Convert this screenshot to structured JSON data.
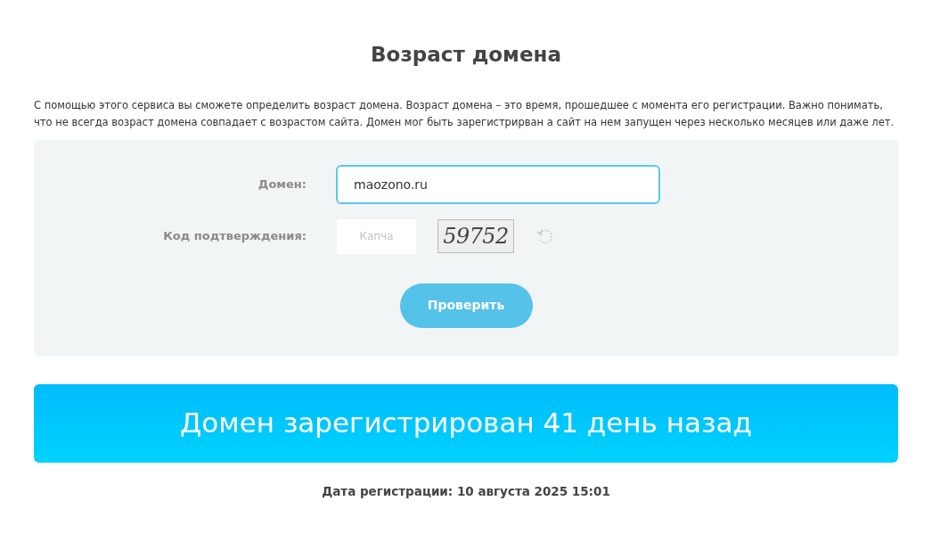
{
  "title": "Возраст домена",
  "description": "С помощью этого сервиса вы сможете определить возраст домена. Возраст домена – это время, прошедшее с момента его регистрации. Важно понимать, что не всегда возраст домена совпадает с возрастом сайта. Домен мог быть зарегистрирван а сайт на нем запущен через несколько месяцев или даже лет.",
  "form": {
    "domain_label": "Домен:",
    "domain_value": "maozono.ru",
    "captcha_label": "Код подтверждения:",
    "captcha_placeholder": "Капча",
    "captcha_code": "59752",
    "submit": "Проверить"
  },
  "result": {
    "headline": "Домен зарегистрирован 41 день назад",
    "date": "Дата регистрации: 10 августа 2025 15:01"
  }
}
